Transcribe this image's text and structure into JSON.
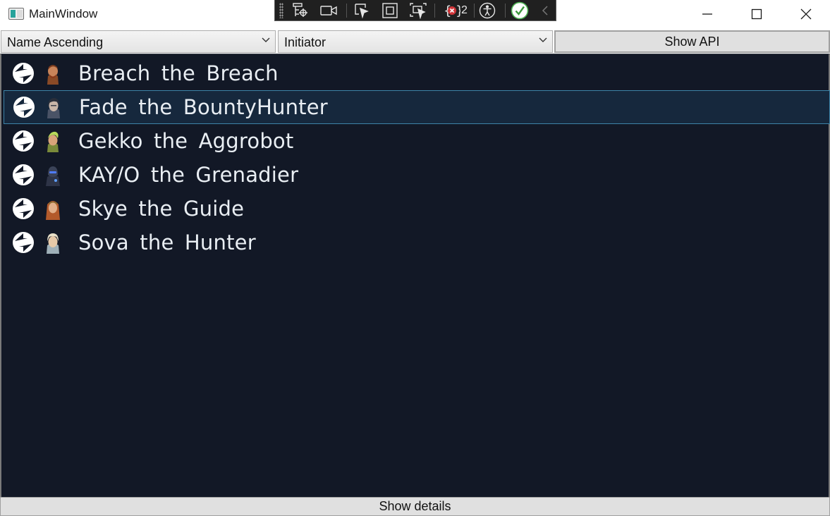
{
  "window": {
    "title": "MainWindow"
  },
  "devbar": {
    "error_count": "2"
  },
  "controls": {
    "sort_combo": {
      "value": "Name Ascending"
    },
    "role_combo": {
      "value": "Initiator"
    },
    "show_api_label": "Show API"
  },
  "agents": [
    {
      "name": "Breach the Breach",
      "selected": false,
      "portrait": "breach-portrait"
    },
    {
      "name": "Fade the BountyHunter",
      "selected": true,
      "portrait": "fade-portrait"
    },
    {
      "name": "Gekko the Aggrobot",
      "selected": false,
      "portrait": "gekko-portrait"
    },
    {
      "name": "KAY/O the Grenadier",
      "selected": false,
      "portrait": "kayo-portrait"
    },
    {
      "name": "Skye the Guide",
      "selected": false,
      "portrait": "skye-portrait"
    },
    {
      "name": "Sova the Hunter",
      "selected": false,
      "portrait": "sova-portrait"
    }
  ],
  "footer": {
    "show_details_label": "Show details"
  },
  "colors": {
    "list_background": "#121826",
    "selection_background": "#16283d",
    "selection_border": "#3d84a8",
    "devbar_background": "#202020"
  }
}
